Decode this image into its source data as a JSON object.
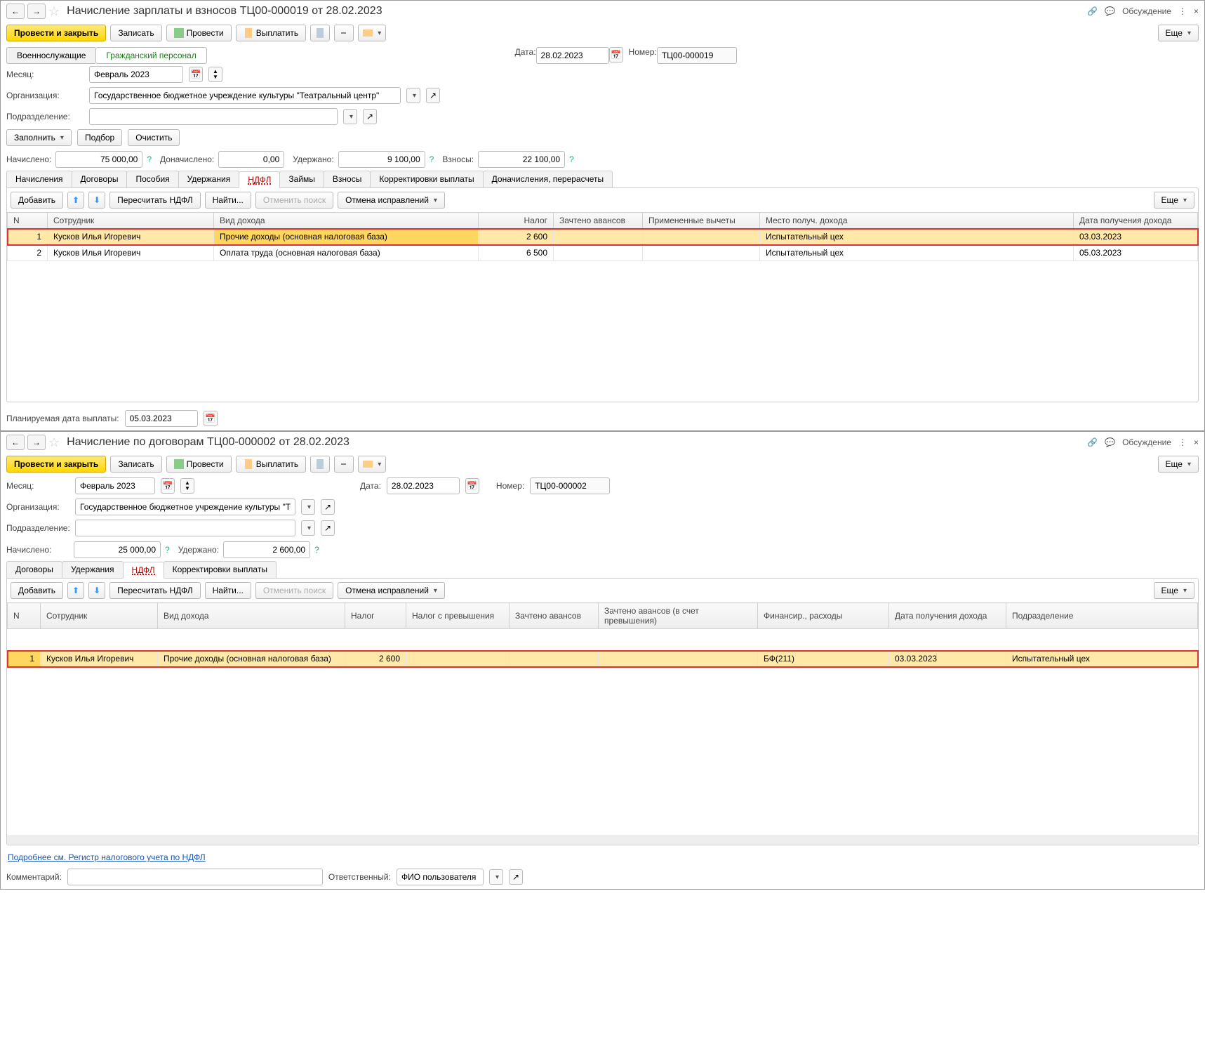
{
  "panel1": {
    "title": "Начисление зарплаты и взносов ТЦ00-000019 от 28.02.2023",
    "discuss": "Обсуждение",
    "toolbar": {
      "post_close": "Провести и закрыть",
      "write": "Записать",
      "post": "Провести",
      "pay": "Выплатить",
      "more": "Еще"
    },
    "subtabs": {
      "military": "Военнослужащие",
      "civil": "Гражданский персонал"
    },
    "fields": {
      "date_lbl": "Дата:",
      "date": "28.02.2023",
      "num_lbl": "Номер:",
      "num": "ТЦ00-000019",
      "month_lbl": "Месяц:",
      "month": "Февраль 2023",
      "org_lbl": "Организация:",
      "org": "Государственное бюджетное учреждение культуры \"Театральный центр\"",
      "dept_lbl": "Подразделение:",
      "fill": "Заполнить",
      "select": "Подбор",
      "clear": "Очистить"
    },
    "summary": {
      "accrued_lbl": "Начислено:",
      "accrued": "75 000,00",
      "additional_lbl": "Доначислено:",
      "additional": "0,00",
      "withheld_lbl": "Удержано:",
      "withheld": "9 100,00",
      "contrib_lbl": "Взносы:",
      "contrib": "22 100,00"
    },
    "tabs": {
      "calc": "Начисления",
      "contracts": "Договоры",
      "benefits": "Пособия",
      "deductions": "Удержания",
      "ndfl": "НДФЛ",
      "loans": "Займы",
      "contributions": "Взносы",
      "corrections": "Корректировки выплаты",
      "recalc": "Доначисления, перерасчеты"
    },
    "tabletoolbar": {
      "add": "Добавить",
      "recalc": "Пересчитать НДФЛ",
      "find": "Найти...",
      "cancel_find": "Отменить поиск",
      "cancel_fix": "Отмена исправлений",
      "more": "Еще"
    },
    "columns": {
      "n": "N",
      "emp": "Сотрудник",
      "income_type": "Вид дохода",
      "tax": "Налог",
      "advance": "Зачтено авансов",
      "deductions_applied": "Примененные вычеты",
      "place": "Место получ. дохода",
      "date_income": "Дата получения дохода"
    },
    "rows": [
      {
        "n": "1",
        "emp": "Кусков Илья Игоревич",
        "income_type": "Прочие доходы (основная налоговая база)",
        "tax": "2 600",
        "advance": "",
        "deductions": "",
        "place": "Испытательный цех",
        "date": "03.03.2023"
      },
      {
        "n": "2",
        "emp": "Кусков Илья Игоревич",
        "income_type": "Оплата труда (основная налоговая база)",
        "tax": "6 500",
        "advance": "",
        "deductions": "",
        "place": "Испытательный цех",
        "date": "05.03.2023"
      }
    ],
    "footer": {
      "planned_lbl": "Планируемая дата выплаты:",
      "planned": "05.03.2023"
    }
  },
  "panel2": {
    "title": "Начисление по договорам ТЦ00-000002 от 28.02.2023",
    "discuss": "Обсуждение",
    "toolbar": {
      "post_close": "Провести и закрыть",
      "write": "Записать",
      "post": "Провести",
      "pay": "Выплатить",
      "more": "Еще"
    },
    "fields": {
      "month_lbl": "Месяц:",
      "month": "Февраль 2023",
      "date_lbl": "Дата:",
      "date": "28.02.2023",
      "num_lbl": "Номер:",
      "num": "ТЦ00-000002",
      "org_lbl": "Организация:",
      "org": "Государственное бюджетное учреждение культуры \"Театраг",
      "dept_lbl": "Подразделение:"
    },
    "summary": {
      "accrued_lbl": "Начислено:",
      "accrued": "25 000,00",
      "withheld_lbl": "Удержано:",
      "withheld": "2 600,00"
    },
    "tabs": {
      "contracts": "Договоры",
      "deductions": "Удержания",
      "ndfl": "НДФЛ",
      "corrections": "Корректировки выплаты"
    },
    "tabletoolbar": {
      "add": "Добавить",
      "recalc": "Пересчитать НДФЛ",
      "find": "Найти...",
      "cancel_find": "Отменить поиск",
      "cancel_fix": "Отмена исправлений",
      "more": "Еще"
    },
    "columns": {
      "n": "N",
      "emp": "Сотрудник",
      "income_type": "Вид дохода",
      "tax": "Налог",
      "tax_excess": "Налог с превышения",
      "advance": "Зачтено авансов",
      "advance_excess": "Зачтено авансов (в счет превышения)",
      "finance": "Финансир., расходы",
      "date_income": "Дата получения дохода",
      "dept": "Подразделение"
    },
    "rows": [
      {
        "n": "1",
        "emp": "Кусков Илья Игоревич",
        "income_type": "Прочие доходы (основная налоговая база)",
        "tax": "2 600",
        "tax_ex": "",
        "adv": "",
        "adv_ex": "",
        "fin": "БФ(211)",
        "date": "03.03.2023",
        "dept": "Испытательный цех"
      }
    ],
    "link": "Подробнее см. Регистр налогового учета по НДФЛ",
    "footer": {
      "comment_lbl": "Комментарий:",
      "resp_lbl": "Ответственный:",
      "resp": "ФИО пользователя"
    }
  }
}
